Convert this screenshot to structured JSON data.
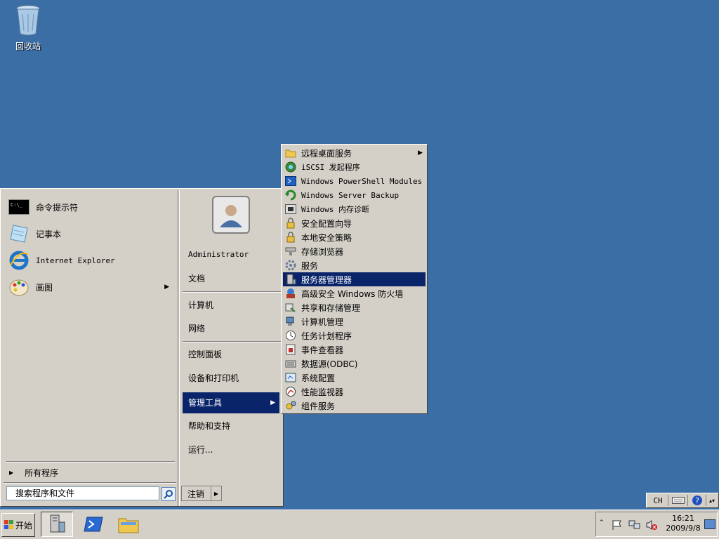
{
  "desktop": {
    "recycle_bin_label": "回收站"
  },
  "start_menu": {
    "pinned": [
      {
        "label": "命令提示符",
        "icon": "cmd-icon"
      },
      {
        "label": "记事本",
        "icon": "notepad-icon"
      },
      {
        "label": "Internet Explorer",
        "icon": "ie-icon"
      },
      {
        "label": "画图",
        "icon": "paint-icon"
      }
    ],
    "all_programs_label": "所有程序",
    "search_placeholder": "搜索程序和文件",
    "user_name": "Administrator",
    "right_items": [
      {
        "label": "文档"
      },
      {
        "label": "计算机"
      },
      {
        "label": "网络"
      },
      {
        "label": "控制面板"
      },
      {
        "label": "设备和打印机"
      },
      {
        "label": "管理工具"
      },
      {
        "label": "帮助和支持"
      },
      {
        "label": "运行..."
      }
    ],
    "logoff_label": "注销"
  },
  "admin_tools_submenu": [
    {
      "label": "远程桌面服务",
      "icon": "folder-icon"
    },
    {
      "label": "iSCSI 发起程序",
      "icon": "iscsi-icon"
    },
    {
      "label": "Windows PowerShell Modules",
      "icon": "powershell-icon"
    },
    {
      "label": "Windows Server Backup",
      "icon": "backup-icon"
    },
    {
      "label": "Windows 内存诊断",
      "icon": "memory-icon"
    },
    {
      "label": "安全配置向导",
      "icon": "security-wizard-icon"
    },
    {
      "label": "本地安全策略",
      "icon": "security-policy-icon"
    },
    {
      "label": "存储浏览器",
      "icon": "storage-icon"
    },
    {
      "label": "服务",
      "icon": "services-icon"
    },
    {
      "label": "服务器管理器",
      "icon": "server-manager-icon"
    },
    {
      "label": "高级安全 Windows 防火墙",
      "icon": "firewall-icon"
    },
    {
      "label": "共享和存储管理",
      "icon": "share-icon"
    },
    {
      "label": "计算机管理",
      "icon": "computer-management-icon"
    },
    {
      "label": "任务计划程序",
      "icon": "clock-icon"
    },
    {
      "label": "事件查看器",
      "icon": "event-viewer-icon"
    },
    {
      "label": "数据源(ODBC)",
      "icon": "odbc-icon"
    },
    {
      "label": "系统配置",
      "icon": "msconfig-icon"
    },
    {
      "label": "性能监视器",
      "icon": "perfmon-icon"
    },
    {
      "label": "组件服务",
      "icon": "component-icon"
    }
  ],
  "taskbar": {
    "start_label": "开始",
    "clock_time": "16:21",
    "clock_date": "2009/9/8"
  },
  "language_bar": {
    "lang": "CH"
  }
}
